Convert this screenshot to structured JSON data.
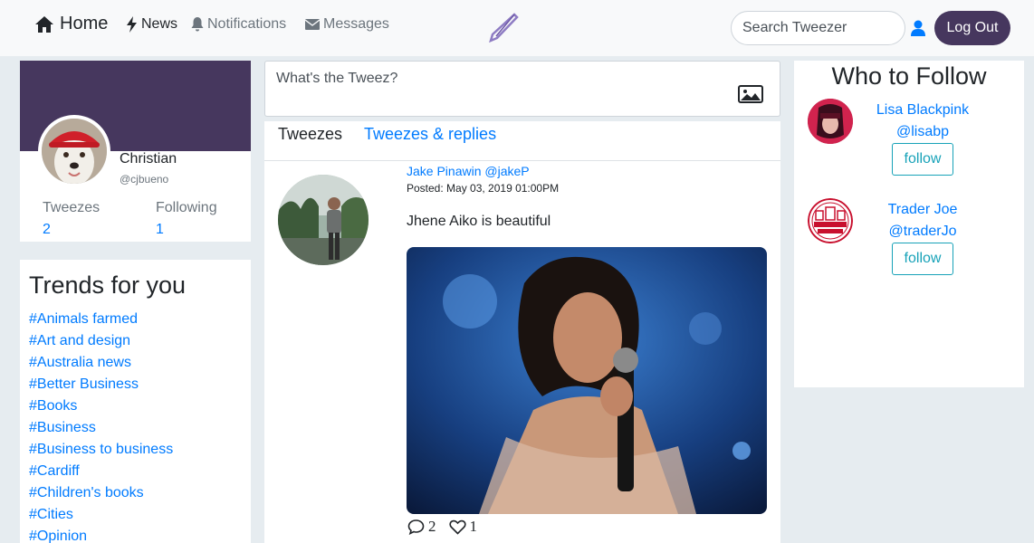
{
  "nav": {
    "home_label": "Home",
    "news_label": "News",
    "notifications_label": "Notifications",
    "messages_label": "Messages",
    "search_placeholder": "Search Tweezer",
    "logout_label": "Log Out",
    "brand_color": "#46375e"
  },
  "profile": {
    "name": "Christian",
    "handle": "@cjbueno",
    "tweezes_label": "Tweezes",
    "tweezes_count": "2",
    "following_label": "Following",
    "following_count": "1"
  },
  "trends": {
    "title": "Trends for you",
    "items": [
      "#Animals farmed",
      "#Art and design",
      "#Australia news",
      "#Better Business",
      "#Books",
      "#Business",
      "#Business to business",
      "#Cardiff",
      "#Children's books",
      "#Cities",
      "#Opinion"
    ]
  },
  "compose": {
    "placeholder": "What's the Tweez?"
  },
  "feed": {
    "tabs": [
      "Tweezes",
      "Tweezes & replies"
    ],
    "post": {
      "author": "Jake Pinawin @jakeP",
      "date": "Posted: May 03, 2019 01:00PM",
      "text": "Jhene Aiko is beautiful",
      "comments": "2",
      "likes": "1"
    }
  },
  "who_to_follow": {
    "title": "Who to Follow",
    "users": [
      {
        "name": "Lisa Blackpink",
        "handle": "@lisabp",
        "button": "follow"
      },
      {
        "name": "Trader Joe",
        "handle": "@traderJo",
        "button": "follow"
      }
    ]
  }
}
